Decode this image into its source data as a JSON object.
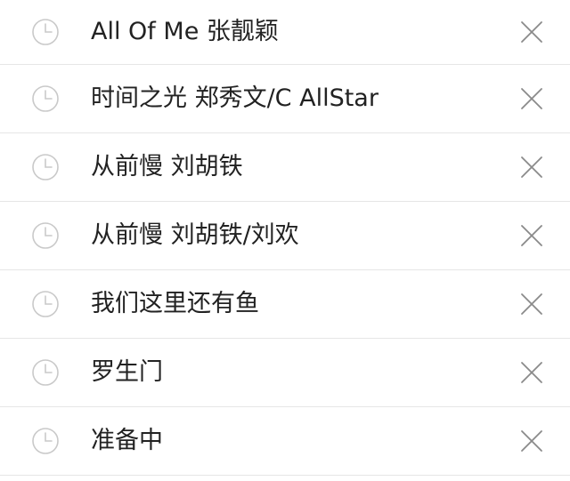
{
  "history": {
    "items": [
      {
        "label": "All Of Me 张靓颖"
      },
      {
        "label": "时间之光 郑秀文/C AllStar"
      },
      {
        "label": "从前慢 刘胡铁"
      },
      {
        "label": "从前慢 刘胡铁/刘欢"
      },
      {
        "label": "我们这里还有鱼"
      },
      {
        "label": "罗生门"
      },
      {
        "label": "准备中"
      }
    ],
    "icons": {
      "leading": "clock-icon",
      "trailing": "close-icon"
    },
    "colors": {
      "text": "#222222",
      "icon": "#c9c9c9",
      "close": "#8a8a8a",
      "divider": "#e6e6e6"
    }
  }
}
